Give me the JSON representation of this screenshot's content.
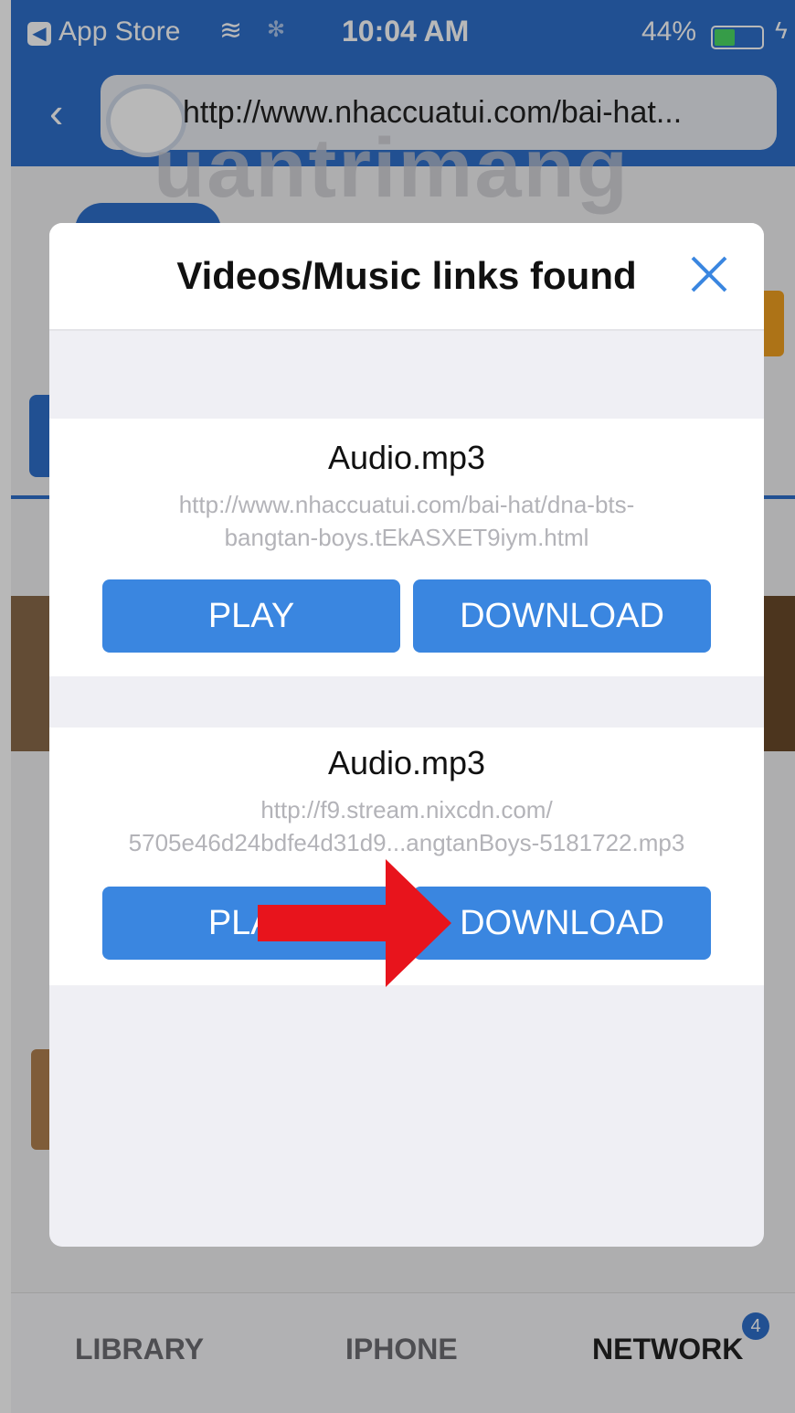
{
  "status_bar": {
    "back_app": "App Store",
    "time": "10:04 AM",
    "battery": "44%"
  },
  "browser": {
    "url": "http://www.nhaccuatui.com/bai-hat..."
  },
  "watermark": "uantrimang",
  "dialog": {
    "title": "Videos/Music links found",
    "links": [
      {
        "name": "Audio.mp3",
        "url_line1": "http://www.nhaccuatui.com/bai-hat/dna-bts-",
        "url_line2": "bangtan-boys.tEkASXET9iym.html",
        "play_label": "PLAY",
        "download_label": "DOWNLOAD"
      },
      {
        "name": "Audio.mp3",
        "url_line1": "http://f9.stream.nixcdn.com/",
        "url_line2": "5705e46d24bdfe4d31d9...angtanBoys-5181722.mp3",
        "play_label": "PLAY",
        "download_label": "DOWNLOAD"
      }
    ]
  },
  "tab_bar": {
    "tabs": [
      "LIBRARY",
      "IPHONE",
      "NETWORK"
    ],
    "network_badge": "4"
  },
  "colors": {
    "accent": "#3a86e0",
    "nav_blue": "#2f6fcb",
    "arrow_red": "#e8141c"
  }
}
